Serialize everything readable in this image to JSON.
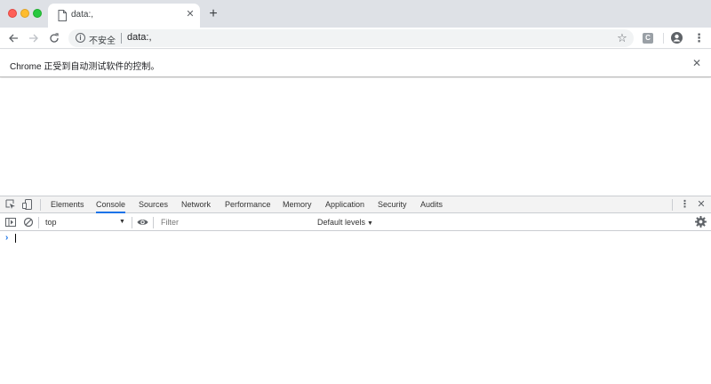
{
  "browser": {
    "tab": {
      "title": "data:,",
      "icon": "page-icon",
      "close": "✕"
    },
    "new_tab": "+",
    "url": "data:,",
    "security_label": "不安全",
    "ext_icon_letter": "C"
  },
  "infobar": {
    "message": "Chrome 正受到自动测试软件的控制。",
    "close": "✕"
  },
  "devtools": {
    "tabs": [
      {
        "label": "Elements",
        "active": false
      },
      {
        "label": "Console",
        "active": true
      },
      {
        "label": "Sources",
        "active": false
      },
      {
        "label": "Network",
        "active": false
      },
      {
        "label": "Performance",
        "active": false
      },
      {
        "label": "Memory",
        "active": false
      },
      {
        "label": "Application",
        "active": false
      },
      {
        "label": "Security",
        "active": false
      },
      {
        "label": "Audits",
        "active": false
      }
    ],
    "console": {
      "context": "top",
      "filter_placeholder": "Filter",
      "filter_value": "",
      "levels": "Default levels",
      "prompt": "›"
    }
  },
  "colors": {
    "accent": "#1a73e8",
    "titlebar": "#dee1e6",
    "devtools_bar": "#f3f3f3"
  }
}
